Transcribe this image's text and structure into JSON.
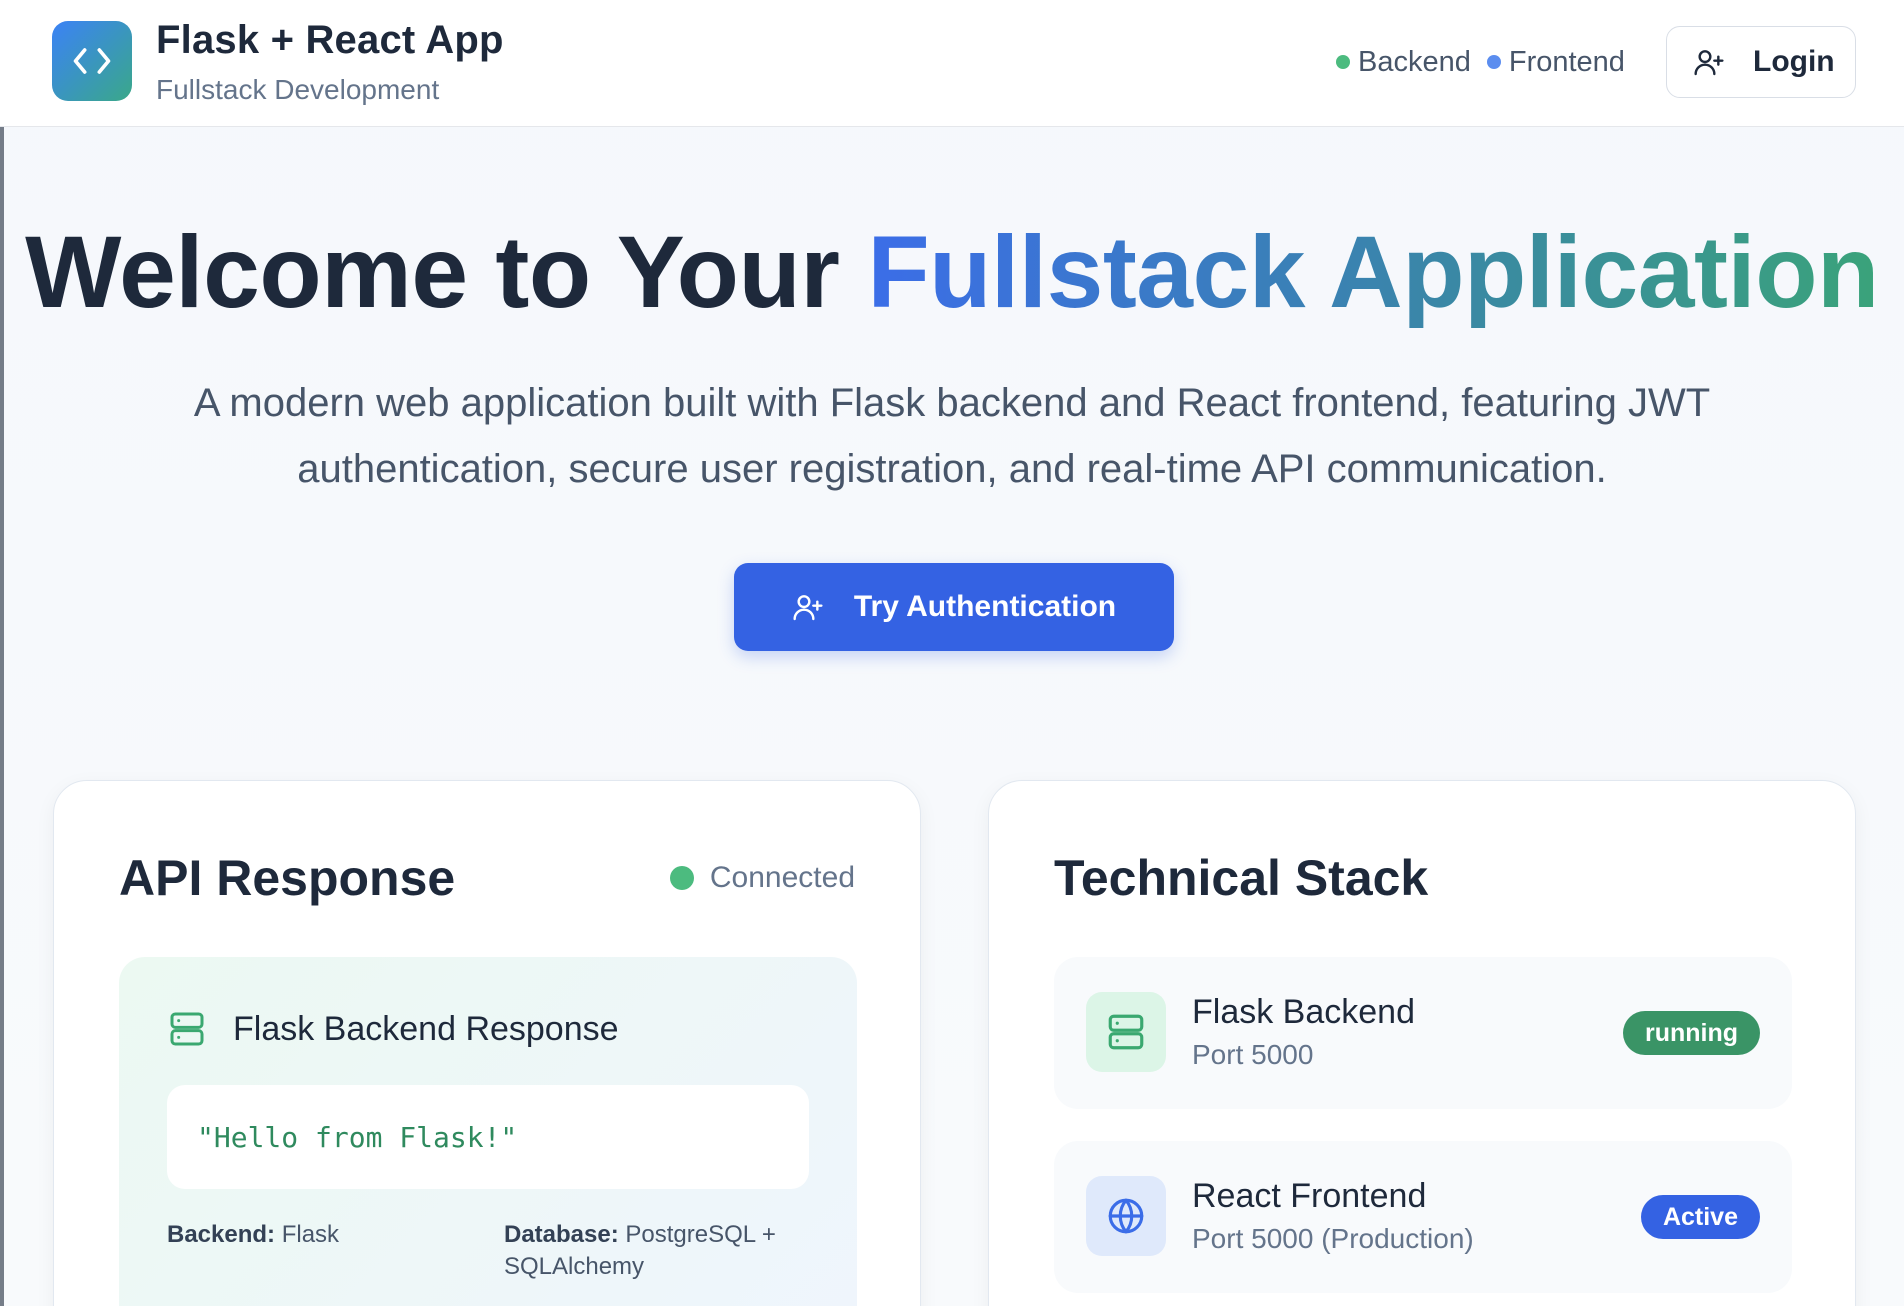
{
  "header": {
    "app_title": "Flask + React App",
    "app_subtitle": "Fullstack Development",
    "logo_icon": "code-icon",
    "status": [
      {
        "label": "Backend",
        "color": "#4cbb7f"
      },
      {
        "label": "Frontend",
        "color": "#5b8def"
      }
    ],
    "login_label": "Login",
    "login_icon": "user-plus-icon"
  },
  "hero": {
    "title_plain": "Welcome to Your ",
    "title_gradient": "Fullstack Application",
    "description": "A modern web application built with Flask backend and React frontend, featuring JWT authentication, secure user registration, and real-time API communication.",
    "cta_label": "Try Authentication",
    "cta_icon": "user-plus-icon"
  },
  "api_card": {
    "title": "API Response",
    "status": "Connected",
    "status_color": "#4cbb7f",
    "response_title": "Flask Backend Response",
    "response_icon": "server-icon",
    "response_value": "\"Hello from Flask!\"",
    "backend_label": "Backend:",
    "backend_value": "Flask",
    "database_label": "Database:",
    "database_value": "PostgreSQL + SQLAlchemy"
  },
  "stack_card": {
    "title": "Technical Stack",
    "items": [
      {
        "name": "Flask Backend",
        "sub": "Port 5000",
        "badge": "running",
        "badge_color": "#3a9466",
        "icon": "server-icon",
        "icon_bg": "#dcf5e7",
        "icon_color": "#3aa870"
      },
      {
        "name": "React Frontend",
        "sub": "Port 5000 (Production)",
        "badge": "Active",
        "badge_color": "#3462e3",
        "icon": "globe-icon",
        "icon_bg": "#dfe9fb",
        "icon_color": "#3b6de8"
      }
    ]
  },
  "colors": {
    "primary": "#3462e3",
    "success": "#4cbb7f",
    "text": "#1e293b",
    "muted": "#64748b"
  }
}
